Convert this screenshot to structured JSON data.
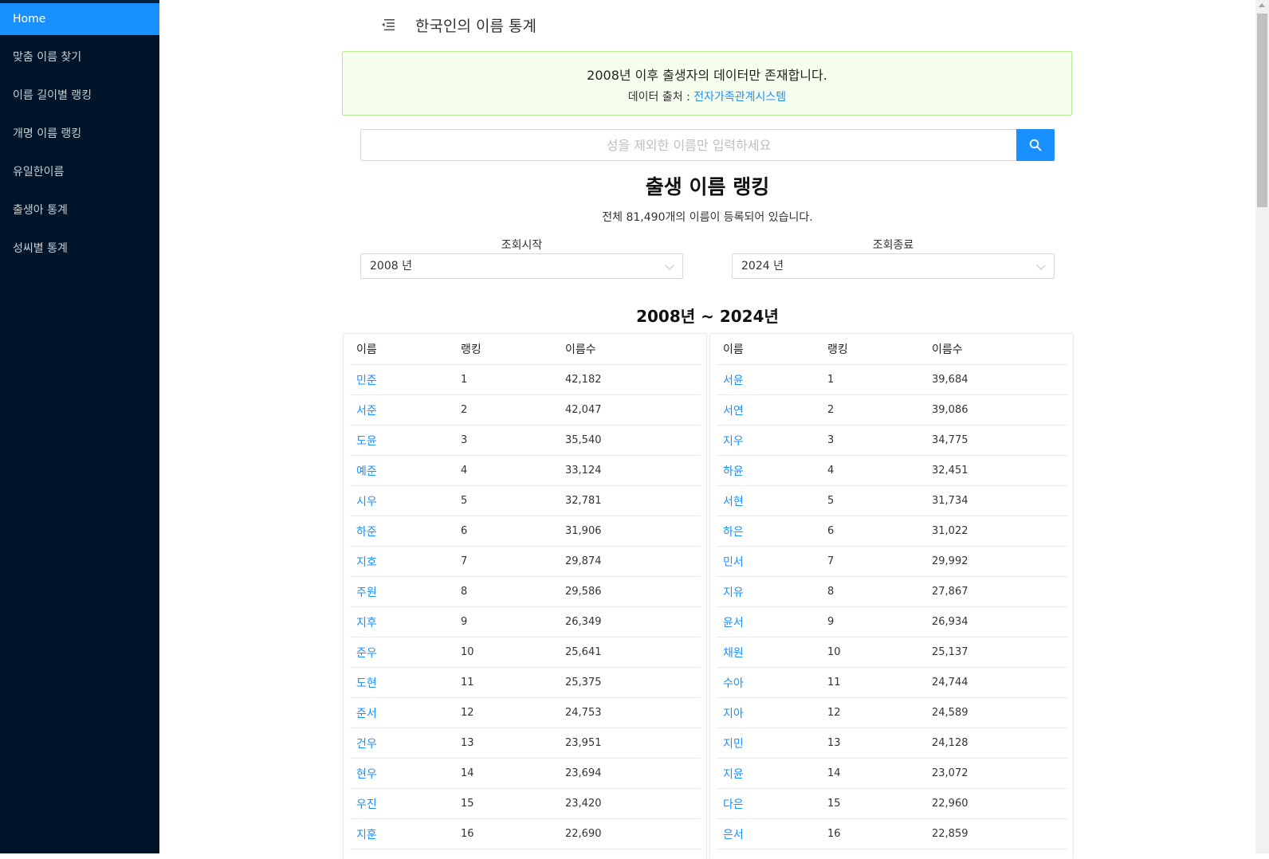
{
  "sidebar": {
    "items": [
      {
        "label": "Home",
        "active": true
      },
      {
        "label": "맞춤 이름 찾기"
      },
      {
        "label": "이름 길이별 랭킹"
      },
      {
        "label": "개명 이름 랭킹"
      },
      {
        "label": "유일한이름"
      },
      {
        "label": "출생아 통계"
      },
      {
        "label": "성씨별 통계"
      }
    ]
  },
  "header": {
    "title": "한국인의 이름 통계",
    "menu_icon": "menu-fold-icon"
  },
  "notice": {
    "main": "2008년 이후 출생자의 데이터만 존재합니다.",
    "source_prefix": "데이터 출처 : ",
    "source_link": "전자가족관계시스템"
  },
  "search": {
    "placeholder": "성을 제외한 이름만 입력하세요",
    "icon": "search-icon"
  },
  "ranking": {
    "title": "출생 이름 랭킹",
    "subtitle": "전체 81,490개의 이름이 등록되어 있습니다.",
    "start_label": "조회시작",
    "start_value": "2008 년",
    "end_label": "조회종료",
    "end_value": "2024 년",
    "period": "2008년 ~ 2024년"
  },
  "tables": {
    "headers": [
      "이름",
      "랭킹",
      "이름수"
    ],
    "left": [
      [
        "민준",
        "1",
        "42,182"
      ],
      [
        "서준",
        "2",
        "42,047"
      ],
      [
        "도윤",
        "3",
        "35,540"
      ],
      [
        "예준",
        "4",
        "33,124"
      ],
      [
        "시우",
        "5",
        "32,781"
      ],
      [
        "하준",
        "6",
        "31,906"
      ],
      [
        "지호",
        "7",
        "29,874"
      ],
      [
        "주원",
        "8",
        "29,586"
      ],
      [
        "지후",
        "9",
        "26,349"
      ],
      [
        "준우",
        "10",
        "25,641"
      ],
      [
        "도현",
        "11",
        "25,375"
      ],
      [
        "준서",
        "12",
        "24,753"
      ],
      [
        "건우",
        "13",
        "23,951"
      ],
      [
        "현우",
        "14",
        "23,694"
      ],
      [
        "우진",
        "15",
        "23,420"
      ],
      [
        "지훈",
        "16",
        "22,690"
      ]
    ],
    "right": [
      [
        "서윤",
        "1",
        "39,684"
      ],
      [
        "서연",
        "2",
        "39,086"
      ],
      [
        "지우",
        "3",
        "34,775"
      ],
      [
        "하윤",
        "4",
        "32,451"
      ],
      [
        "서현",
        "5",
        "31,734"
      ],
      [
        "하은",
        "6",
        "31,022"
      ],
      [
        "민서",
        "7",
        "29,992"
      ],
      [
        "지유",
        "8",
        "27,867"
      ],
      [
        "윤서",
        "9",
        "26,934"
      ],
      [
        "채원",
        "10",
        "25,137"
      ],
      [
        "수아",
        "11",
        "24,744"
      ],
      [
        "지아",
        "12",
        "24,589"
      ],
      [
        "지민",
        "13",
        "24,128"
      ],
      [
        "지윤",
        "14",
        "23,072"
      ],
      [
        "다은",
        "15",
        "22,960"
      ],
      [
        "은서",
        "16",
        "22,859"
      ]
    ]
  },
  "colors": {
    "sidebar_bg": "#001529",
    "accent": "#1890ff",
    "notice_bg": "#f6ffed",
    "notice_border": "#b7eb8f"
  }
}
